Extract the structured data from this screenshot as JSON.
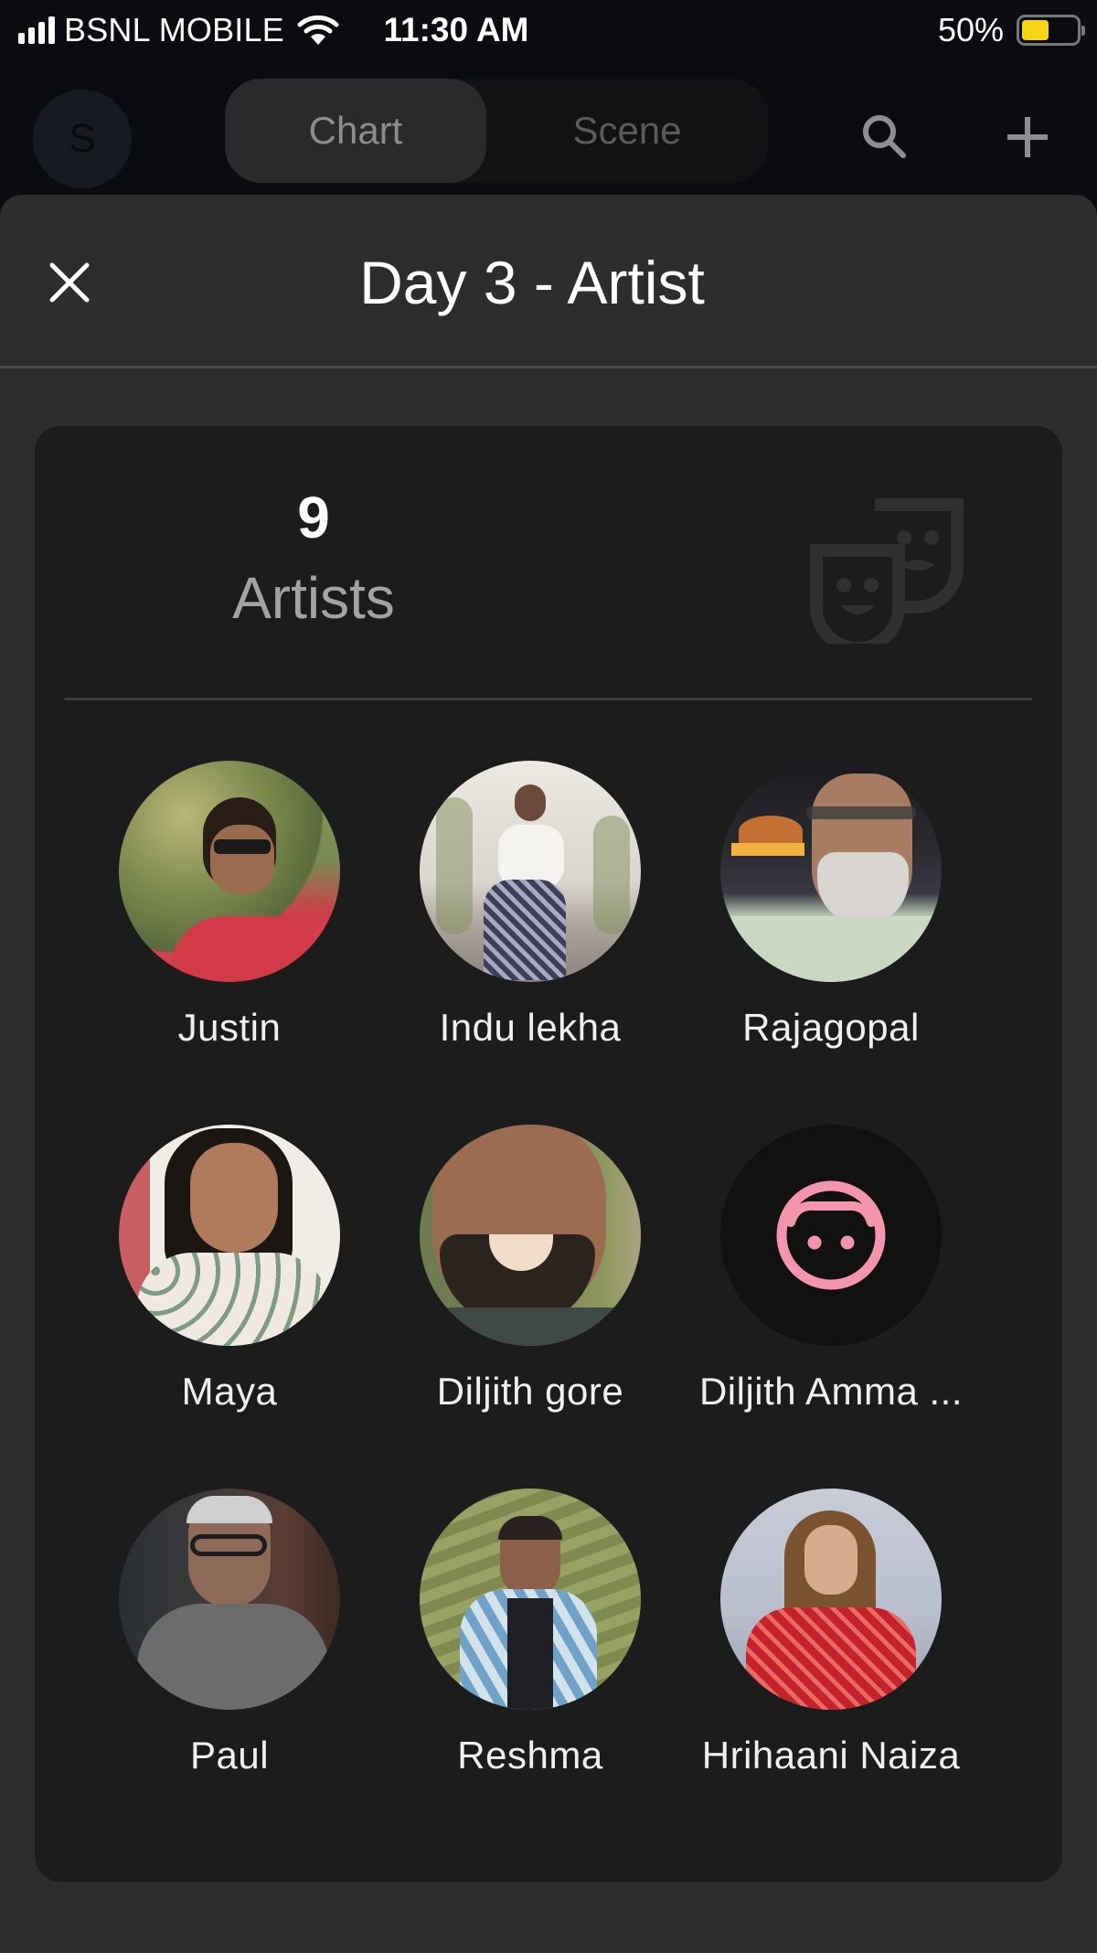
{
  "status_bar": {
    "carrier": "BSNL MOBILE",
    "time": "11:30 AM",
    "battery_percent_label": "50%",
    "battery_level": 0.5,
    "battery_color": "#f5d515",
    "signal_bars": 4,
    "icons": [
      "signal-icon",
      "wifi-icon",
      "battery-icon"
    ]
  },
  "top_nav": {
    "profile_initial": "S",
    "tabs": [
      {
        "label": "Chart",
        "active": true
      },
      {
        "label": "Scene",
        "active": false
      }
    ],
    "icons": [
      "search-icon",
      "plus-icon"
    ]
  },
  "sheet": {
    "title": "Day 3 - Artist",
    "close_icon": "close-icon"
  },
  "summary": {
    "count": "9",
    "label": "Artists",
    "icon": "theater-masks-icon"
  },
  "artists": [
    {
      "name": "Justin",
      "avatar": "photo"
    },
    {
      "name": "Indu lekha",
      "avatar": "photo"
    },
    {
      "name": "Rajagopal",
      "avatar": "photo"
    },
    {
      "name": "Maya",
      "avatar": "photo"
    },
    {
      "name": "Diljith gore",
      "avatar": "photo"
    },
    {
      "name": "Diljith Amma ...",
      "avatar": "placeholder-face-icon",
      "placeholder_color": "#f495ad"
    },
    {
      "name": "Paul",
      "avatar": "photo"
    },
    {
      "name": "Reshma",
      "avatar": "photo"
    },
    {
      "name": "Hrihaani Naiza",
      "avatar": "photo"
    }
  ],
  "colors": {
    "background": "#0b0c10",
    "sheet": "#2d2d2d",
    "card": "#1c1c1c",
    "accent_pink": "#f495ad"
  }
}
